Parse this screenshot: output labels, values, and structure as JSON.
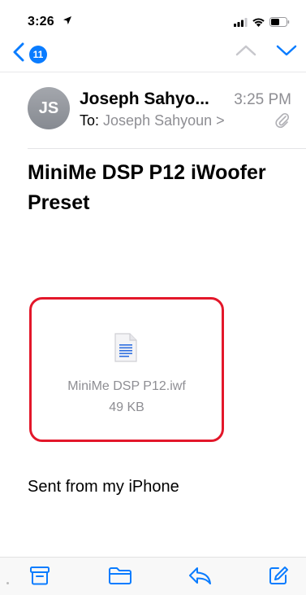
{
  "status": {
    "time": "3:26",
    "signal_icon": "signal-icon",
    "wifi_icon": "wifi-icon",
    "battery_icon": "battery-icon",
    "location_icon": "location-arrow-icon"
  },
  "nav": {
    "back_badge": "11",
    "back_icon": "chevron-left-icon",
    "prev_icon": "chevron-up-icon",
    "next_icon": "chevron-down-icon"
  },
  "header": {
    "avatar_initials": "JS",
    "sender": "Joseph Sahyo...",
    "time": "3:25 PM",
    "to_label": "To:",
    "to_name": "Joseph Sahyoun >"
  },
  "subject": "MiniMe DSP P12 iWoofer Preset",
  "attachment": {
    "name": "MiniMe DSP P12.iwf",
    "size": "49 KB",
    "icon": "document-icon"
  },
  "body": {
    "signature": "Sent from my iPhone"
  },
  "toolbar": {
    "items": [
      "archive-icon",
      "folder-icon",
      "reply-icon",
      "compose-icon"
    ]
  },
  "colors": {
    "accent": "#0a7cff",
    "highlight_border": "#e3172a",
    "secondary_text": "#8e8e93"
  }
}
